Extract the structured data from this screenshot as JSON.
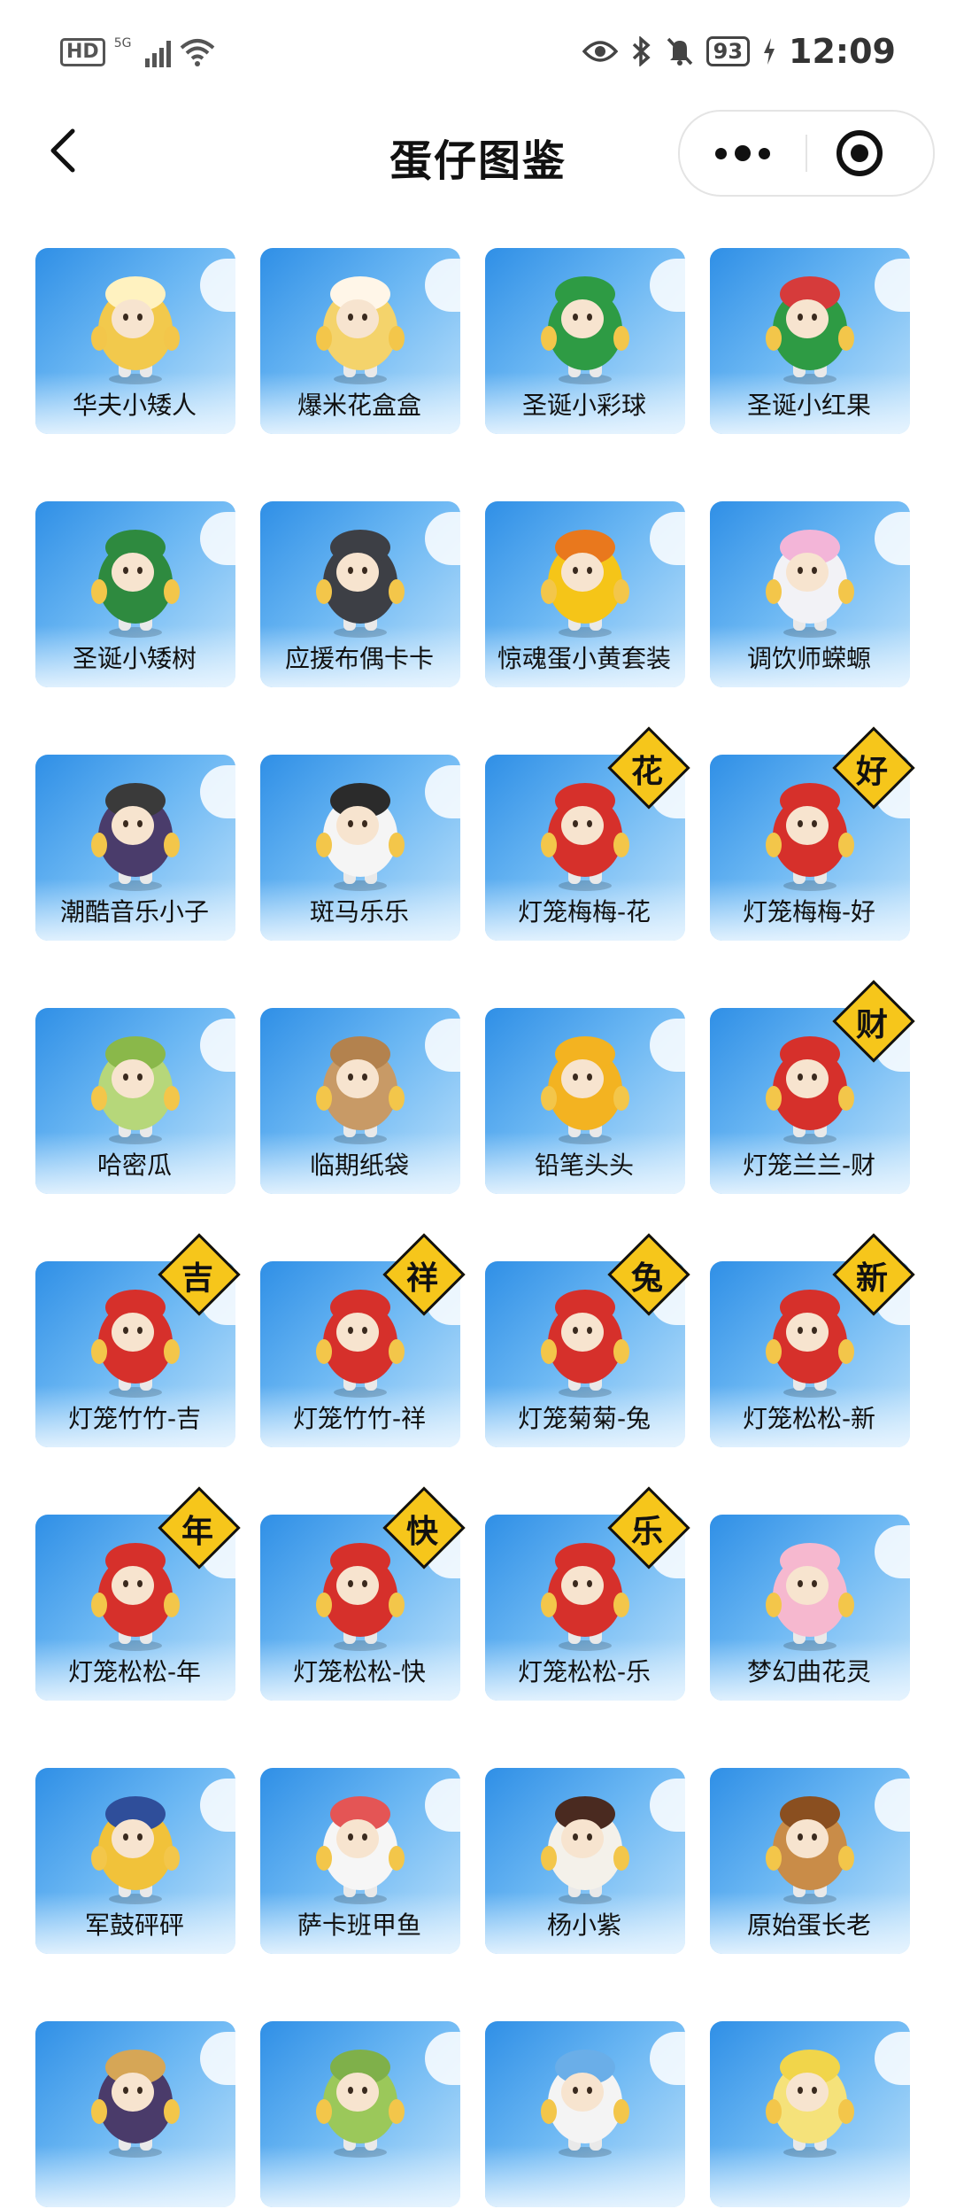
{
  "status": {
    "hd": "HD",
    "network": "5G",
    "battery": "93",
    "time": "12:09"
  },
  "nav": {
    "title": "蛋仔图鉴"
  },
  "items": [
    {
      "label": "华夫小矮人",
      "body": "#f2c94c",
      "hat": "#fff2c0",
      "tag": ""
    },
    {
      "label": "爆米花盒盒",
      "body": "#f4d36b",
      "hat": "#fff6e8",
      "tag": ""
    },
    {
      "label": "圣诞小彩球",
      "body": "#2e9b44",
      "hat": "#2e9b44",
      "tag": ""
    },
    {
      "label": "圣诞小红果",
      "body": "#2e9b44",
      "hat": "#d63b3b",
      "tag": ""
    },
    {
      "label": "圣诞小矮树",
      "body": "#2e8a3f",
      "hat": "#2e8a3f",
      "tag": ""
    },
    {
      "label": "应援布偶卡卡",
      "body": "#3d3f45",
      "hat": "#3d3f45",
      "tag": ""
    },
    {
      "label": "惊魂蛋小黄套装",
      "body": "#f5c518",
      "hat": "#e9781d",
      "tag": ""
    },
    {
      "label": "调饮师蝾螈",
      "body": "#f2f2f6",
      "hat": "#f3b5d8",
      "tag": ""
    },
    {
      "label": "潮酷音乐小子",
      "body": "#4a3c6b",
      "hat": "#3a3a3a",
      "tag": ""
    },
    {
      "label": "斑马乐乐",
      "body": "#f5f5f5",
      "hat": "#2b2b2b",
      "tag": ""
    },
    {
      "label": "灯笼梅梅-花",
      "body": "#d6302b",
      "hat": "#d6302b",
      "tag": "花"
    },
    {
      "label": "灯笼梅梅-好",
      "body": "#d6302b",
      "hat": "#d6302b",
      "tag": "好"
    },
    {
      "label": "哈密瓜",
      "body": "#b6d77a",
      "hat": "#8ab84a",
      "tag": ""
    },
    {
      "label": "临期纸袋",
      "body": "#c89a66",
      "hat": "#b3824e",
      "tag": ""
    },
    {
      "label": "铅笔头头",
      "body": "#f3b321",
      "hat": "#f3b321",
      "tag": ""
    },
    {
      "label": "灯笼兰兰-财",
      "body": "#d6302b",
      "hat": "#d6302b",
      "tag": "财"
    },
    {
      "label": "灯笼竹竹-吉",
      "body": "#d6302b",
      "hat": "#d6302b",
      "tag": "吉"
    },
    {
      "label": "灯笼竹竹-祥",
      "body": "#d6302b",
      "hat": "#d6302b",
      "tag": "祥"
    },
    {
      "label": "灯笼菊菊-兔",
      "body": "#d6302b",
      "hat": "#d6302b",
      "tag": "兔"
    },
    {
      "label": "灯笼松松-新",
      "body": "#d6302b",
      "hat": "#d6302b",
      "tag": "新"
    },
    {
      "label": "灯笼松松-年",
      "body": "#d6302b",
      "hat": "#d6302b",
      "tag": "年"
    },
    {
      "label": "灯笼松松-快",
      "body": "#d6302b",
      "hat": "#d6302b",
      "tag": "快"
    },
    {
      "label": "灯笼松松-乐",
      "body": "#d6302b",
      "hat": "#d6302b",
      "tag": "乐"
    },
    {
      "label": "梦幻曲花灵",
      "body": "#f6b8cf",
      "hat": "#f6b8cf",
      "tag": ""
    },
    {
      "label": "军鼓砰砰",
      "body": "#f1c23a",
      "hat": "#2f4e9a",
      "tag": ""
    },
    {
      "label": "萨卡班甲鱼",
      "body": "#f6f6f6",
      "hat": "#e45555",
      "tag": ""
    },
    {
      "label": "杨小紫",
      "body": "#f4f1ea",
      "hat": "#4a2a20",
      "tag": ""
    },
    {
      "label": "原始蛋长老",
      "body": "#c98c48",
      "hat": "#8a4f20",
      "tag": ""
    },
    {
      "label": "",
      "body": "#4a3b6a",
      "hat": "#d6a656",
      "tag": ""
    },
    {
      "label": "",
      "body": "#9bc85a",
      "hat": "#7fb04a",
      "tag": ""
    },
    {
      "label": "",
      "body": "#f4f4f4",
      "hat": "#6aaee8",
      "tag": ""
    },
    {
      "label": "",
      "body": "#f5e27a",
      "hat": "#f1d54a",
      "tag": ""
    }
  ]
}
